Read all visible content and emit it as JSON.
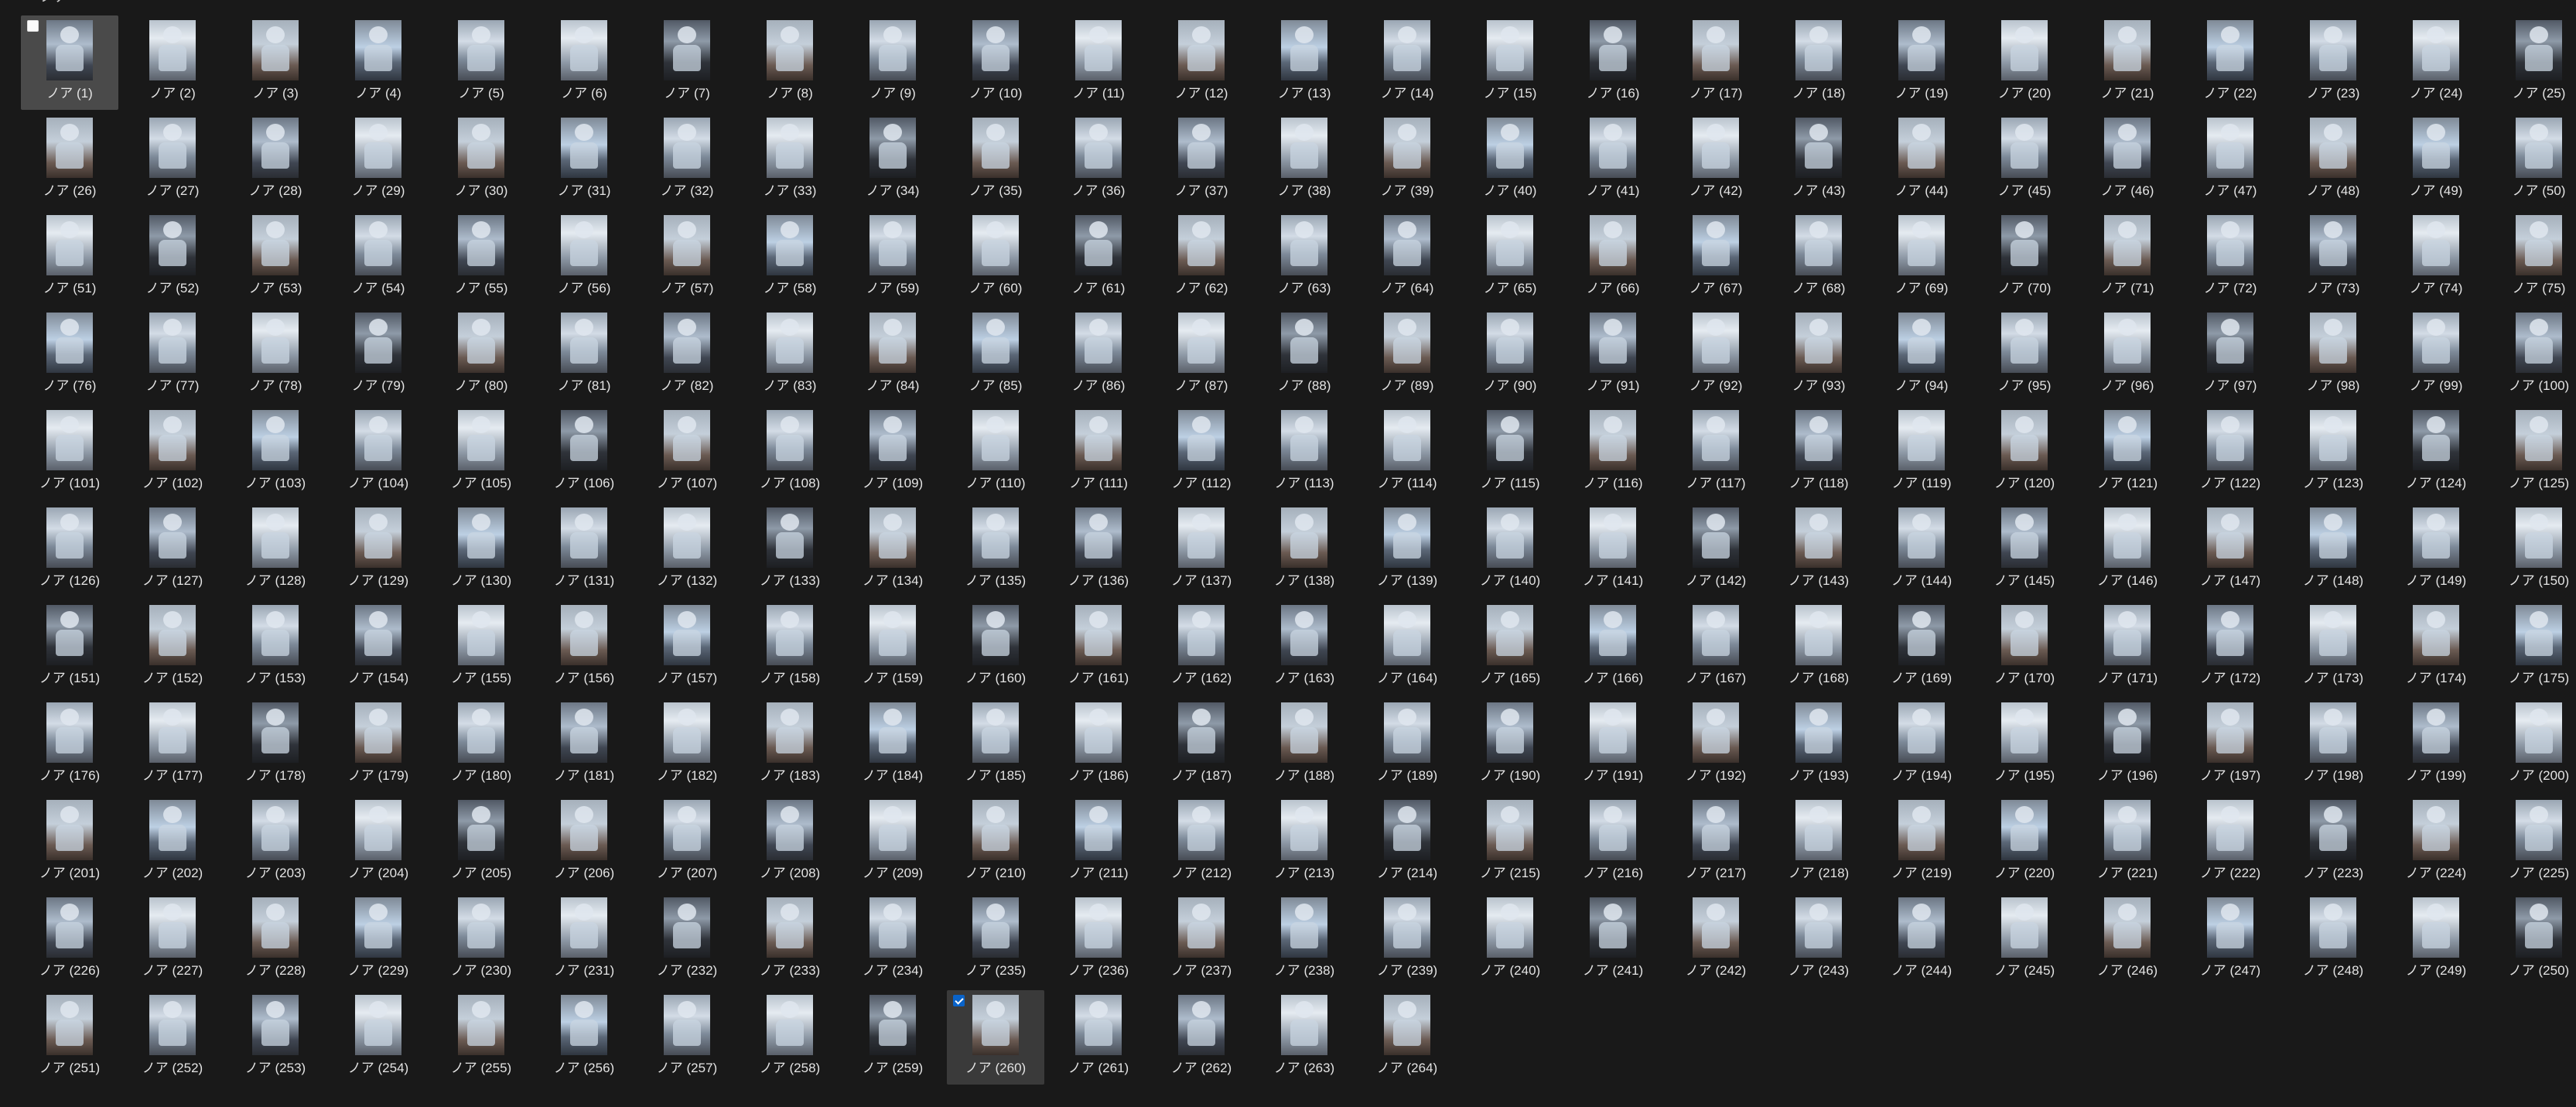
{
  "header": {
    "peek_text": "ノア"
  },
  "selection": {
    "first_selected_index": 1,
    "checked_index": 260
  },
  "files": [
    "ノア (1)",
    "ノア (2)",
    "ノア (3)",
    "ノア (4)",
    "ノア (5)",
    "ノア (6)",
    "ノア (7)",
    "ノア (8)",
    "ノア (9)",
    "ノア (10)",
    "ノア (11)",
    "ノア (12)",
    "ノア (13)",
    "ノア (14)",
    "ノア (15)",
    "ノア (16)",
    "ノア (17)",
    "ノア (18)",
    "ノア (19)",
    "ノア (20)",
    "ノア (21)",
    "ノア (22)",
    "ノア (23)",
    "ノア (24)",
    "ノア (25)",
    "ノア (26)",
    "ノア (27)",
    "ノア (28)",
    "ノア (29)",
    "ノア (30)",
    "ノア (31)",
    "ノア (32)",
    "ノア (33)",
    "ノア (34)",
    "ノア (35)",
    "ノア (36)",
    "ノア (37)",
    "ノア (38)",
    "ノア (39)",
    "ノア (40)",
    "ノア (41)",
    "ノア (42)",
    "ノア (43)",
    "ノア (44)",
    "ノア (45)",
    "ノア (46)",
    "ノア (47)",
    "ノア (48)",
    "ノア (49)",
    "ノア (50)",
    "ノア (51)",
    "ノア (52)",
    "ノア (53)",
    "ノア (54)",
    "ノア (55)",
    "ノア (56)",
    "ノア (57)",
    "ノア (58)",
    "ノア (59)",
    "ノア (60)",
    "ノア (61)",
    "ノア (62)",
    "ノア (63)",
    "ノア (64)",
    "ノア (65)",
    "ノア (66)",
    "ノア (67)",
    "ノア (68)",
    "ノア (69)",
    "ノア (70)",
    "ノア (71)",
    "ノア (72)",
    "ノア (73)",
    "ノア (74)",
    "ノア (75)",
    "ノア (76)",
    "ノア (77)",
    "ノア (78)",
    "ノア (79)",
    "ノア (80)",
    "ノア (81)",
    "ノア (82)",
    "ノア (83)",
    "ノア (84)",
    "ノア (85)",
    "ノア (86)",
    "ノア (87)",
    "ノア (88)",
    "ノア (89)",
    "ノア (90)",
    "ノア (91)",
    "ノア (92)",
    "ノア (93)",
    "ノア (94)",
    "ノア (95)",
    "ノア (96)",
    "ノア (97)",
    "ノア (98)",
    "ノア (99)",
    "ノア (100)",
    "ノア (101)",
    "ノア (102)",
    "ノア (103)",
    "ノア (104)",
    "ノア (105)",
    "ノア (106)",
    "ノア (107)",
    "ノア (108)",
    "ノア (109)",
    "ノア (110)",
    "ノア (111)",
    "ノア (112)",
    "ノア (113)",
    "ノア (114)",
    "ノア (115)",
    "ノア (116)",
    "ノア (117)",
    "ノア (118)",
    "ノア (119)",
    "ノア (120)",
    "ノア (121)",
    "ノア (122)",
    "ノア (123)",
    "ノア (124)",
    "ノア (125)",
    "ノア (126)",
    "ノア (127)",
    "ノア (128)",
    "ノア (129)",
    "ノア (130)",
    "ノア (131)",
    "ノア (132)",
    "ノア (133)",
    "ノア (134)",
    "ノア (135)",
    "ノア (136)",
    "ノア (137)",
    "ノア (138)",
    "ノア (139)",
    "ノア (140)",
    "ノア (141)",
    "ノア (142)",
    "ノア (143)",
    "ノア (144)",
    "ノア (145)",
    "ノア (146)",
    "ノア (147)",
    "ノア (148)",
    "ノア (149)",
    "ノア (150)",
    "ノア (151)",
    "ノア (152)",
    "ノア (153)",
    "ノア (154)",
    "ノア (155)",
    "ノア (156)",
    "ノア (157)",
    "ノア (158)",
    "ノア (159)",
    "ノア (160)",
    "ノア (161)",
    "ノア (162)",
    "ノア (163)",
    "ノア (164)",
    "ノア (165)",
    "ノア (166)",
    "ノア (167)",
    "ノア (168)",
    "ノア (169)",
    "ノア (170)",
    "ノア (171)",
    "ノア (172)",
    "ノア (173)",
    "ノア (174)",
    "ノア (175)",
    "ノア (176)",
    "ノア (177)",
    "ノア (178)",
    "ノア (179)",
    "ノア (180)",
    "ノア (181)",
    "ノア (182)",
    "ノア (183)",
    "ノア (184)",
    "ノア (185)",
    "ノア (186)",
    "ノア (187)",
    "ノア (188)",
    "ノア (189)",
    "ノア (190)",
    "ノア (191)",
    "ノア (192)",
    "ノア (193)",
    "ノア (194)",
    "ノア (195)",
    "ノア (196)",
    "ノア (197)",
    "ノア (198)",
    "ノア (199)",
    "ノア (200)",
    "ノア (201)",
    "ノア (202)",
    "ノア (203)",
    "ノア (204)",
    "ノア (205)",
    "ノア (206)",
    "ノア (207)",
    "ノア (208)",
    "ノア (209)",
    "ノア (210)",
    "ノア (211)",
    "ノア (212)",
    "ノア (213)",
    "ノア (214)",
    "ノア (215)",
    "ノア (216)",
    "ノア (217)",
    "ノア (218)",
    "ノア (219)",
    "ノア (220)",
    "ノア (221)",
    "ノア (222)",
    "ノア (223)",
    "ノア (224)",
    "ノア (225)",
    "ノア (226)",
    "ノア (227)",
    "ノア (228)",
    "ノア (229)",
    "ノア (230)",
    "ノア (231)",
    "ノア (232)",
    "ノア (233)",
    "ノア (234)",
    "ノア (235)",
    "ノア (236)",
    "ノア (237)",
    "ノア (238)",
    "ノア (239)",
    "ノア (240)",
    "ノア (241)",
    "ノア (242)",
    "ノア (243)",
    "ノア (244)",
    "ノア (245)",
    "ノア (246)",
    "ノア (247)",
    "ノア (248)",
    "ノア (249)",
    "ノア (250)",
    "ノア (251)",
    "ノア (252)",
    "ノア (253)",
    "ノア (254)",
    "ノア (255)",
    "ノア (256)",
    "ノア (257)",
    "ノア (258)",
    "ノア (259)",
    "ノア (260)",
    "ノア (261)",
    "ノア (262)",
    "ノア (263)",
    "ノア (264)"
  ]
}
